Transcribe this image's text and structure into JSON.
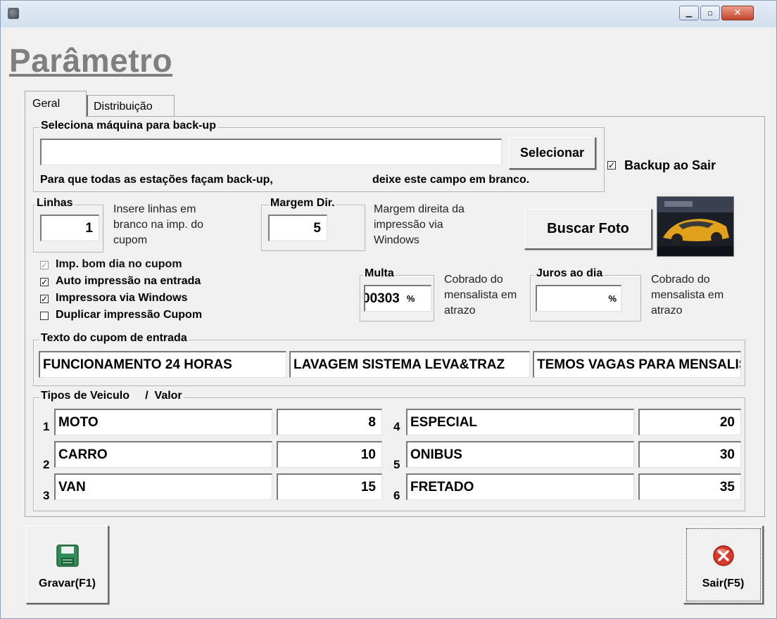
{
  "window": {
    "title": "Parâmetro"
  },
  "tabs": [
    {
      "label": "Geral"
    },
    {
      "label": "Distribuição"
    }
  ],
  "backup": {
    "group_label": "Seleciona máquina para back-up",
    "machine_value": "",
    "select_label": "Selecionar",
    "hint_left": "Para que todas as  estações façam back-up,",
    "hint_right": "deixe este campo em branco.",
    "backup_on_exit_label": "Backup ao Sair",
    "backup_on_exit_checked": true
  },
  "lines": {
    "group_label": "Linhas",
    "value": "1",
    "desc": "Insere linhas  em branco na imp. do cupom"
  },
  "margin": {
    "group_label": "Margem Dir.",
    "value": "5",
    "desc": "Margem direita da impressão via Windows"
  },
  "photo": {
    "button_label": "Buscar Foto"
  },
  "print_options": [
    {
      "label": "Imp. bom dia no cupom",
      "checked": true,
      "disabled": true
    },
    {
      "label": "Auto impressão na entrada",
      "checked": true,
      "disabled": false
    },
    {
      "label": "Impressora via Windows",
      "checked": true,
      "disabled": false
    },
    {
      "label": "Duplicar impressão Cupom",
      "checked": false,
      "disabled": false
    }
  ],
  "fine": {
    "group_label": "Multa",
    "value": "00303",
    "unit": "%",
    "desc": "Cobrado do mensalista em atrazo"
  },
  "interest": {
    "group_label": "Juros ao dia",
    "value": "",
    "unit": "%",
    "desc": "Cobrado do mensalista em atrazo"
  },
  "coupon": {
    "group_label": "Texto do cupom de entrada",
    "lines": [
      "FUNCIONAMENTO 24 HORAS",
      "LAVAGEM SISTEMA LEVA&TRAZ",
      "TEMOS VAGAS PARA MENSALISTAS"
    ]
  },
  "vehicles": {
    "group_label": "Tipos de Veiculo     /  Valor",
    "rows": [
      {
        "num": "1",
        "type": "MOTO",
        "value": "8"
      },
      {
        "num": "2",
        "type": "CARRO",
        "value": "10"
      },
      {
        "num": "3",
        "type": "VAN",
        "value": "15"
      },
      {
        "num": "4",
        "type": "ESPECIAL",
        "value": "20"
      },
      {
        "num": "5",
        "type": "ONIBUS",
        "value": "30"
      },
      {
        "num": "6",
        "type": "FRETADO",
        "value": "35"
      }
    ]
  },
  "footer": {
    "save_label": "Gravar(F1)",
    "exit_label": "Sair(F5)"
  },
  "colors": {
    "save_icon": "#2f8c54",
    "exit_icon": "#d83a2a",
    "title": "#7f7f7f"
  }
}
